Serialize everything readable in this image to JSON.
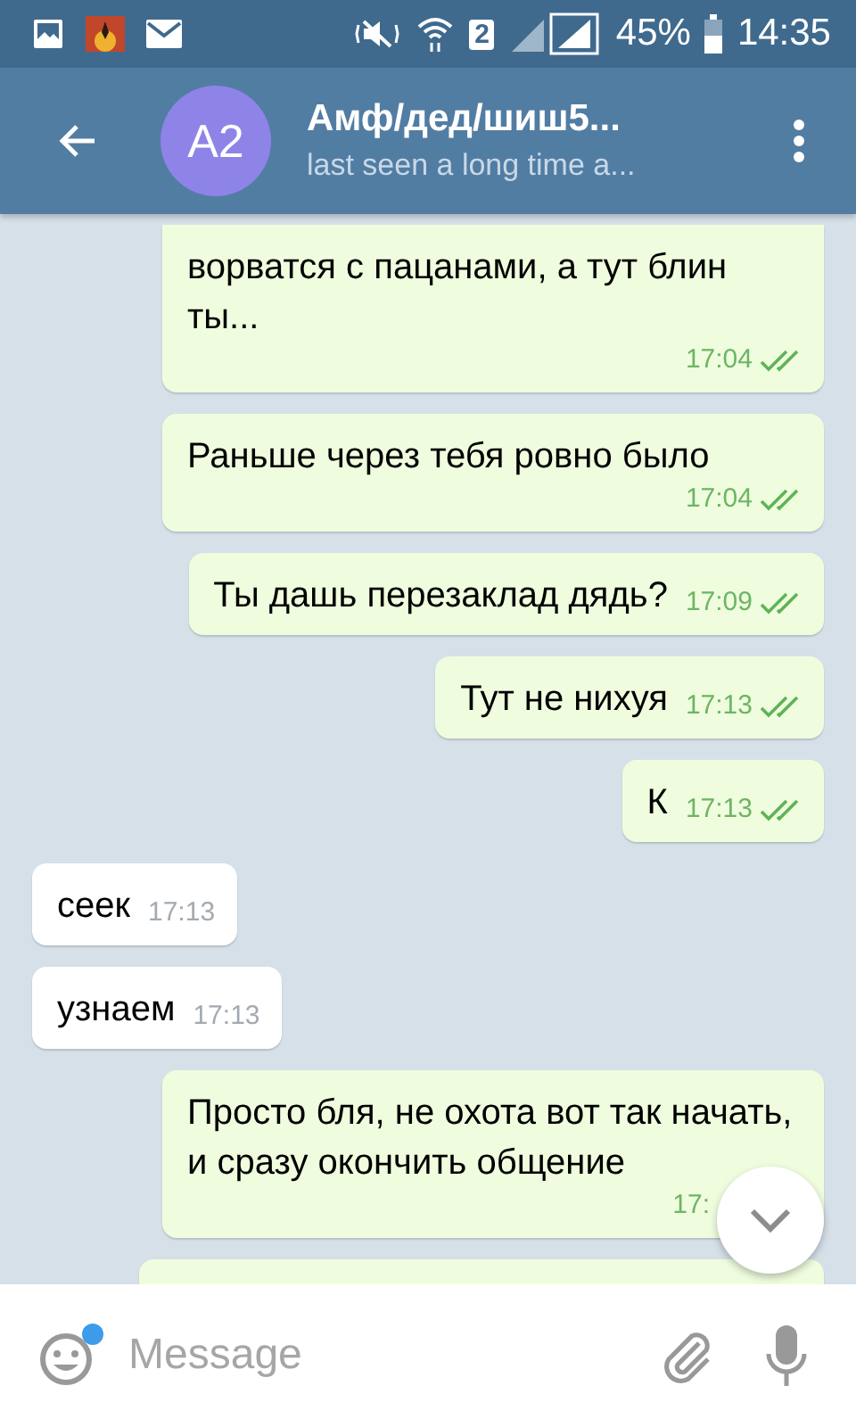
{
  "status_bar": {
    "battery": "45%",
    "time": "14:35",
    "sim": "2"
  },
  "header": {
    "avatar": "A2",
    "title": "Амф/дед/шиш5...",
    "subtitle": "last seen a long time a..."
  },
  "messages": [
    {
      "kind": "out",
      "text": "ворватся с пацанами, а тут блин ты...",
      "time": "17:04",
      "read": true
    },
    {
      "kind": "out",
      "text": "Раньше через тебя ровно было",
      "time": "17:04",
      "read": true
    },
    {
      "kind": "out",
      "text": "Ты дашь перезаклад дядь?",
      "time": "17:09",
      "read": true
    },
    {
      "kind": "out",
      "text": "Тут не нихуя",
      "time": "17:13",
      "read": true
    },
    {
      "kind": "out",
      "text": "К",
      "time": "17:13",
      "read": true
    },
    {
      "kind": "in",
      "text": "сеек",
      "time": "17:13"
    },
    {
      "kind": "in",
      "text": "узнаем",
      "time": "17:13"
    },
    {
      "kind": "out",
      "text": "Просто бля, не охота вот так начать, и сразу окончить общение",
      "time": "17:",
      "read": false
    },
    {
      "kind": "cut"
    }
  ],
  "input": {
    "placeholder": "Message",
    "emoji_badge": true
  }
}
